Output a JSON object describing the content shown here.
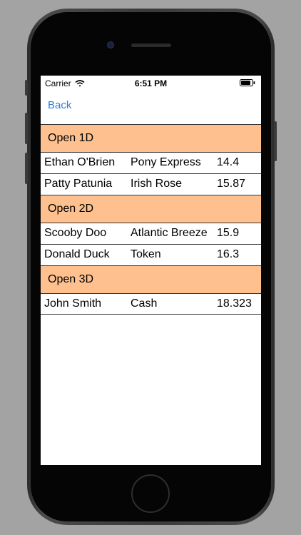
{
  "status_bar": {
    "carrier": "Carrier",
    "time": "6:51 PM",
    "wifi_icon": "wifi-icon",
    "battery_icon": "battery-icon"
  },
  "nav": {
    "back_label": "Back"
  },
  "colors": {
    "section_header_bg": "#fec08e",
    "link": "#2f7ed8"
  },
  "sections": [
    {
      "title": "Open 1D",
      "rows": [
        {
          "rider": "Ethan O'Brien",
          "horse": "Pony Express",
          "time": "14.4"
        },
        {
          "rider": "Patty Patunia",
          "horse": "Irish Rose",
          "time": "15.87"
        }
      ]
    },
    {
      "title": "Open 2D",
      "rows": [
        {
          "rider": "Scooby Doo",
          "horse": "Atlantic Breeze",
          "time": "15.9"
        },
        {
          "rider": "Donald Duck",
          "horse": "Token",
          "time": "16.3"
        }
      ]
    },
    {
      "title": "Open 3D",
      "rows": [
        {
          "rider": "John Smith",
          "horse": "Cash",
          "time": "18.323"
        }
      ]
    }
  ]
}
